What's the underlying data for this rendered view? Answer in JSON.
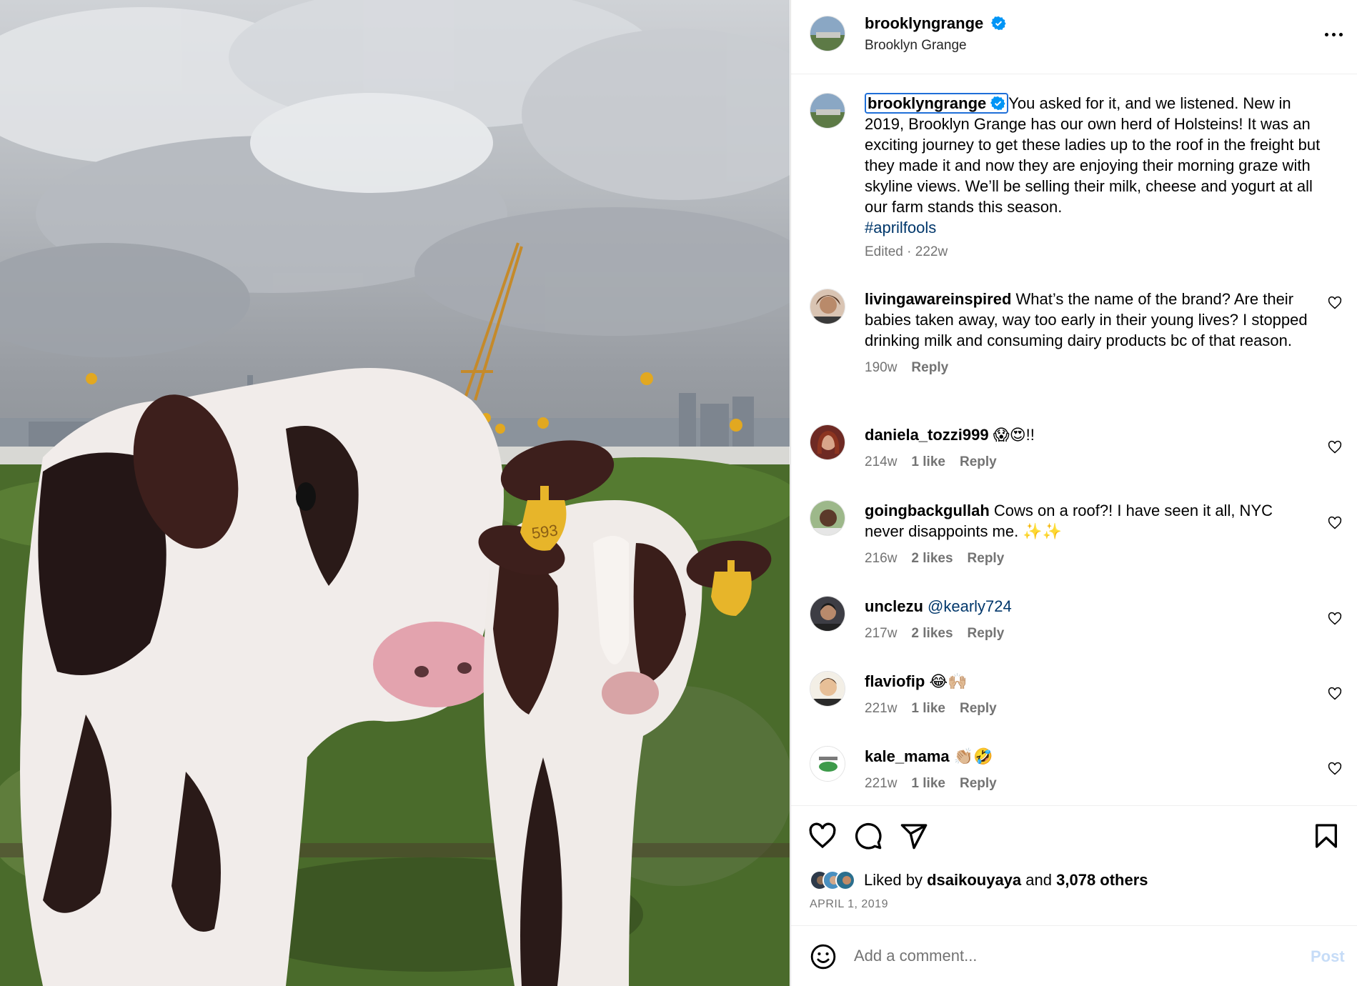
{
  "post": {
    "username": "brooklyngrange",
    "full_name": "Brooklyn Grange",
    "caption": "You asked for it, and we listened. New in 2019, Brooklyn Grange has our own herd of Holsteins! It was an exciting journey to get these ladies up to the roof in the freight but they made it and now they are enjoying their morning graze with skyline views. We’ll be selling their milk, cheese and yogurt at all our farm stands this season.",
    "hashtag": "#aprilfools",
    "edited_meta": "Edited · 222w",
    "ear_tag_number": "593"
  },
  "comments": [
    {
      "username": "livingawareinspired",
      "text": "What’s the name of the brand? Are their babies taken away, way too early in their young lives? I stopped drinking milk and consuming dairy products bc of that reason.",
      "time": "190w",
      "likes": "",
      "reply": "Reply"
    },
    {
      "username": "daniela_tozzi999",
      "text": "😱😍!!",
      "time": "214w",
      "likes": "1 like",
      "reply": "Reply"
    },
    {
      "username": "goingbackgullah",
      "text": "Cows on a roof?! I have seen it all, NYC never disappoints me. ✨✨",
      "time": "216w",
      "likes": "2 likes",
      "reply": "Reply"
    },
    {
      "username": "unclezu",
      "text": "@kearly724",
      "time": "217w",
      "likes": "2 likes",
      "reply": "Reply"
    },
    {
      "username": "flaviofip",
      "text": "😂🙌🏼",
      "time": "221w",
      "likes": "1 like",
      "reply": "Reply"
    },
    {
      "username": "kale_mama",
      "text": "👏🏼🤣",
      "time": "221w",
      "likes": "1 like",
      "reply": "Reply"
    }
  ],
  "likes": {
    "prefix": "Liked by",
    "top_liker": "dsaikouyaya",
    "joiner": "and",
    "others": "3,078 others"
  },
  "date": "APRIL 1, 2019",
  "comment_box": {
    "placeholder": "Add a comment...",
    "post_label": "Post"
  },
  "colors": {
    "verified": "#0095f6",
    "link": "#00376b",
    "secondary_text": "#737373",
    "focus_ring": "#1f6fd8",
    "post_disabled": "#c6dcf7"
  },
  "icons": [
    "verified-badge-icon",
    "more-options-icon",
    "heart-icon",
    "comment-icon",
    "share-icon",
    "bookmark-icon",
    "emoji-icon"
  ]
}
